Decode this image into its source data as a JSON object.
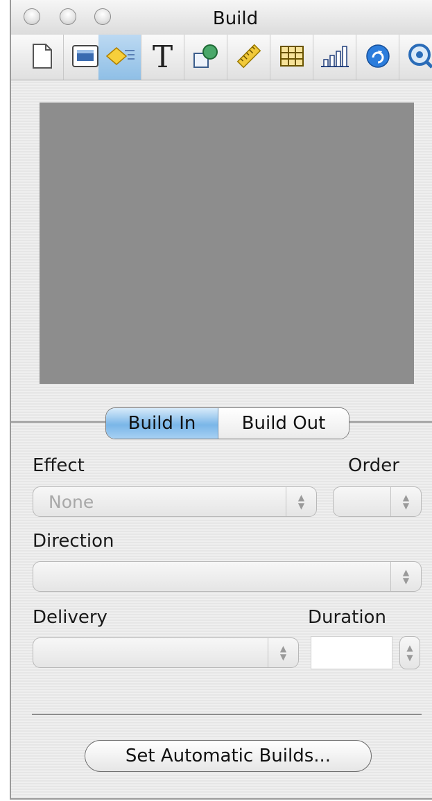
{
  "window": {
    "title": "Build"
  },
  "toolbar": {
    "items": [
      {
        "icon": "document-icon"
      },
      {
        "icon": "slide-icon"
      },
      {
        "icon": "build-icon",
        "active": true
      },
      {
        "icon": "text-icon",
        "glyph": "T"
      },
      {
        "icon": "shapes-icon"
      },
      {
        "icon": "ruler-icon"
      },
      {
        "icon": "table-icon"
      },
      {
        "icon": "chart-icon"
      },
      {
        "icon": "hyperlink-icon"
      },
      {
        "icon": "quicktime-icon"
      }
    ]
  },
  "segmented": {
    "build_in": "Build In",
    "build_out": "Build Out",
    "selected": "Build In"
  },
  "fields": {
    "effect_label": "Effect",
    "effect_value": "None",
    "order_label": "Order",
    "order_value": "",
    "direction_label": "Direction",
    "direction_value": "",
    "delivery_label": "Delivery",
    "delivery_value": "",
    "duration_label": "Duration",
    "duration_value": ""
  },
  "buttons": {
    "automatic_builds": "Set Automatic Builds..."
  },
  "colors": {
    "selected_segment": "#7ab6e8",
    "preview_bg": "#8d8d8d",
    "active_tool": "#9fc8ec"
  }
}
